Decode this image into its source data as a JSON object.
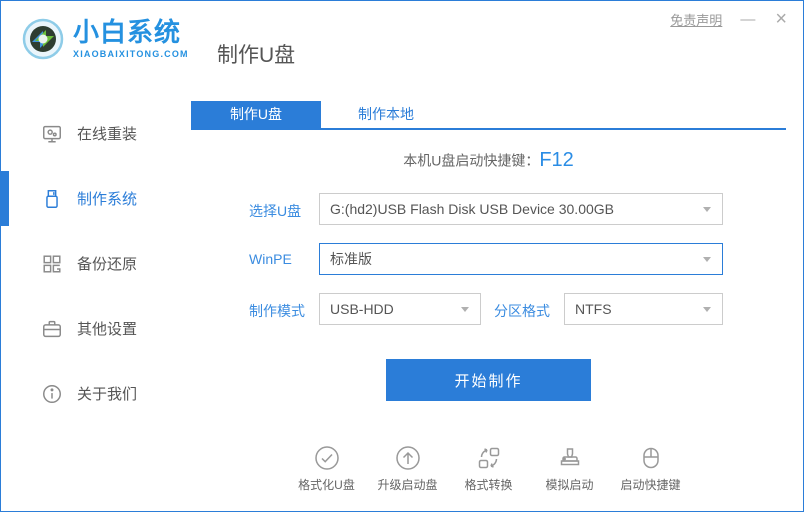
{
  "titlebar": {
    "disclaimer_link": "免责声明",
    "minimize_label": "—",
    "close_label": "×"
  },
  "header": {
    "logo_title": "小白系统",
    "logo_subtitle": "XIAOBAIXITONG.COM",
    "page_title": "制作U盘"
  },
  "sidebar": {
    "items": [
      {
        "label": "在线重装",
        "icon": "monitor-icon",
        "active": false
      },
      {
        "label": "制作系统",
        "icon": "usb-drive-icon",
        "active": true
      },
      {
        "label": "备份还原",
        "icon": "backup-grid-icon",
        "active": false
      },
      {
        "label": "其他设置",
        "icon": "briefcase-icon",
        "active": false
      },
      {
        "label": "关于我们",
        "icon": "info-icon",
        "active": false
      }
    ]
  },
  "tabs": [
    {
      "label": "制作U盘",
      "active": true
    },
    {
      "label": "制作本地",
      "active": false
    }
  ],
  "form": {
    "hotkey_label": "本机U盘启动快捷键：",
    "hotkey_value": "F12",
    "usb_select": {
      "label": "选择U盘",
      "value": "G:(hd2)USB Flash Disk USB Device 30.00GB"
    },
    "winpe_select": {
      "label": "WinPE",
      "value": "标准版"
    },
    "mode_select": {
      "label": "制作模式",
      "value": "USB-HDD"
    },
    "partition_select": {
      "label": "分区格式",
      "value": "NTFS"
    },
    "start_button": "开始制作"
  },
  "footer": {
    "tools": [
      {
        "label": "格式化U盘",
        "icon": "format-check-icon"
      },
      {
        "label": "升级启动盘",
        "icon": "upgrade-arrow-icon"
      },
      {
        "label": "格式转换",
        "icon": "convert-icon"
      },
      {
        "label": "模拟启动",
        "icon": "simulate-stamp-icon"
      },
      {
        "label": "启动快捷键",
        "icon": "boot-hotkey-mouse-icon"
      }
    ]
  },
  "colors": {
    "primary_blue": "#2b7dd8",
    "logo_blue": "#2591e0",
    "label_blue": "#3b8ce0",
    "logo_green": "#6abf3a",
    "text_dark": "#555555",
    "text_gray": "#999999"
  }
}
